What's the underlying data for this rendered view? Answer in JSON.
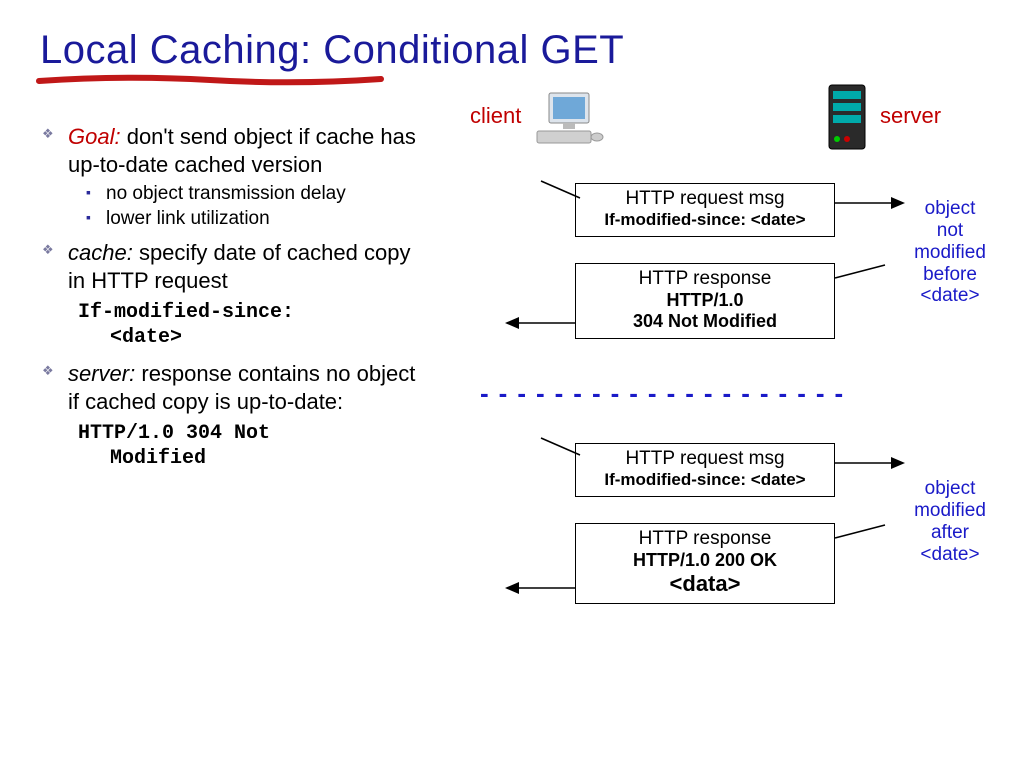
{
  "title": "Local Caching: Conditional GET",
  "bullets": {
    "goal_label": "Goal:",
    "goal_text": " don't send object if cache has up-to-date cached version",
    "goal_sub1": "no object transmission delay",
    "goal_sub2": "lower link utilization",
    "cache_label": "cache:",
    "cache_text": " specify date of cached copy in HTTP request",
    "cache_code1": "If-modified-since:",
    "cache_code2": "<date>",
    "server_label": "server:",
    "server_text": " response contains no object if cached copy is up-to-date:",
    "server_code1": "HTTP/1.0 304 Not",
    "server_code2": "Modified"
  },
  "diagram": {
    "client_label": "client",
    "server_label": "server",
    "req1_l1": "HTTP request msg",
    "req1_l2": "If-modified-since: <date>",
    "resp1_l1": "HTTP response",
    "resp1_l2": "HTTP/1.0",
    "resp1_l3": "304 Not Modified",
    "note1": "object\nnot\nmodified\nbefore\n<date>",
    "req2_l1": "HTTP request msg",
    "req2_l2": "If-modified-since: <date>",
    "resp2_l1": "HTTP response",
    "resp2_l2": "HTTP/1.0 200 OK",
    "resp2_l3": "<data>",
    "note2": "object\nmodified\nafter\n<date>"
  }
}
